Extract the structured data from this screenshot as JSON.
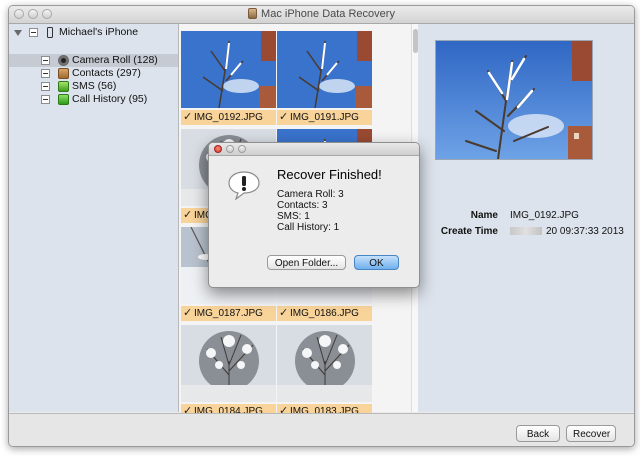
{
  "window": {
    "title": "Mac iPhone Data Recovery"
  },
  "sidebar": {
    "device": "Michael's iPhone",
    "items": [
      {
        "label": "Camera Roll (128)",
        "icon": "camera-icon"
      },
      {
        "label": "Contacts (297)",
        "icon": "contacts-icon"
      },
      {
        "label": "SMS (56)",
        "icon": "sms-icon"
      },
      {
        "label": "Call History (95)",
        "icon": "call-history-icon"
      }
    ]
  },
  "grid": {
    "photos": [
      {
        "name": "IMG_0192.JPG",
        "checked": true,
        "scene": "branches-sky"
      },
      {
        "name": "IMG_0191.JPG",
        "checked": true,
        "scene": "branches-sky"
      },
      {
        "name": "IMG_",
        "checked": true,
        "scene": "snowy-tree"
      },
      {
        "name": "",
        "checked": true,
        "scene": "branches-sky"
      },
      {
        "name": "IMG_0187.JPG",
        "checked": true,
        "scene": "snow-close"
      },
      {
        "name": "IMG_0186.JPG",
        "checked": true,
        "scene": "snow-close"
      },
      {
        "name": "IMG_0184.JPG",
        "checked": true,
        "scene": "snowy-tree"
      },
      {
        "name": "IMG_0183.JPG",
        "checked": true,
        "scene": "snowy-tree"
      }
    ],
    "check_glyph": "✓"
  },
  "details": {
    "name_label": "Name",
    "name_value": "IMG_0192.JPG",
    "time_label": "Create Time",
    "time_value": "20 09:37:33 2013"
  },
  "modal": {
    "title": "Recover Finished!",
    "stats": [
      "Camera Roll: 3",
      "Contacts: 3",
      "SMS: 1",
      "Call History: 1"
    ],
    "open_folder_label": "Open Folder...",
    "ok_label": "OK"
  },
  "buttons": {
    "back_label": "Back",
    "recover_label": "Recover"
  },
  "colors": {
    "caption": "#f8d39a",
    "sidebar": "#dde3ec",
    "ok_button": "#8fc1ef",
    "sky": "#3f7bd3"
  }
}
